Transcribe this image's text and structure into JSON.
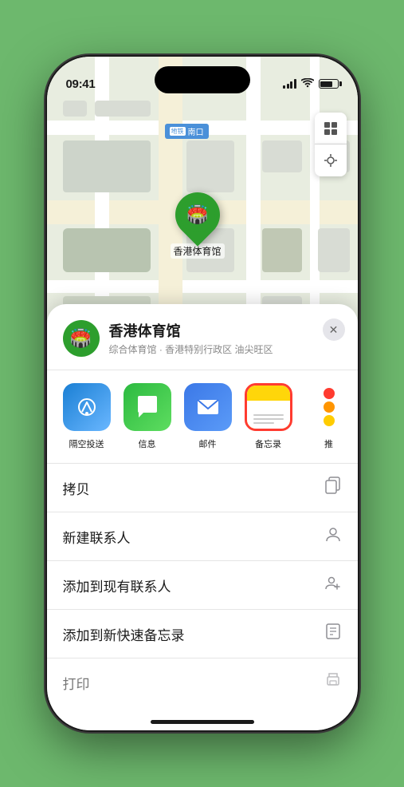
{
  "status_bar": {
    "time": "09:41",
    "location_arrow": "▲"
  },
  "map": {
    "label_text": "南口",
    "location_name": "香港体育馆",
    "pin_label": "香港体育馆"
  },
  "location_card": {
    "name": "香港体育馆",
    "subtitle": "综合体育馆 · 香港特别行政区 油尖旺区"
  },
  "share_items": [
    {
      "id": "airdrop",
      "label": "隔空投送",
      "type": "airdrop"
    },
    {
      "id": "messages",
      "label": "信息",
      "type": "messages"
    },
    {
      "id": "mail",
      "label": "邮件",
      "type": "mail"
    },
    {
      "id": "notes",
      "label": "备忘录",
      "type": "notes"
    },
    {
      "id": "more",
      "label": "推",
      "type": "more"
    }
  ],
  "action_rows": [
    {
      "id": "copy",
      "label": "拷贝",
      "icon": "📋"
    },
    {
      "id": "new_contact",
      "label": "新建联系人",
      "icon": "👤"
    },
    {
      "id": "add_to_contact",
      "label": "添加到现有联系人",
      "icon": "👥"
    },
    {
      "id": "add_to_notes",
      "label": "添加到新快速备忘录",
      "icon": "📝"
    },
    {
      "id": "print",
      "label": "打印",
      "icon": "🖨️"
    }
  ],
  "close_label": "×"
}
